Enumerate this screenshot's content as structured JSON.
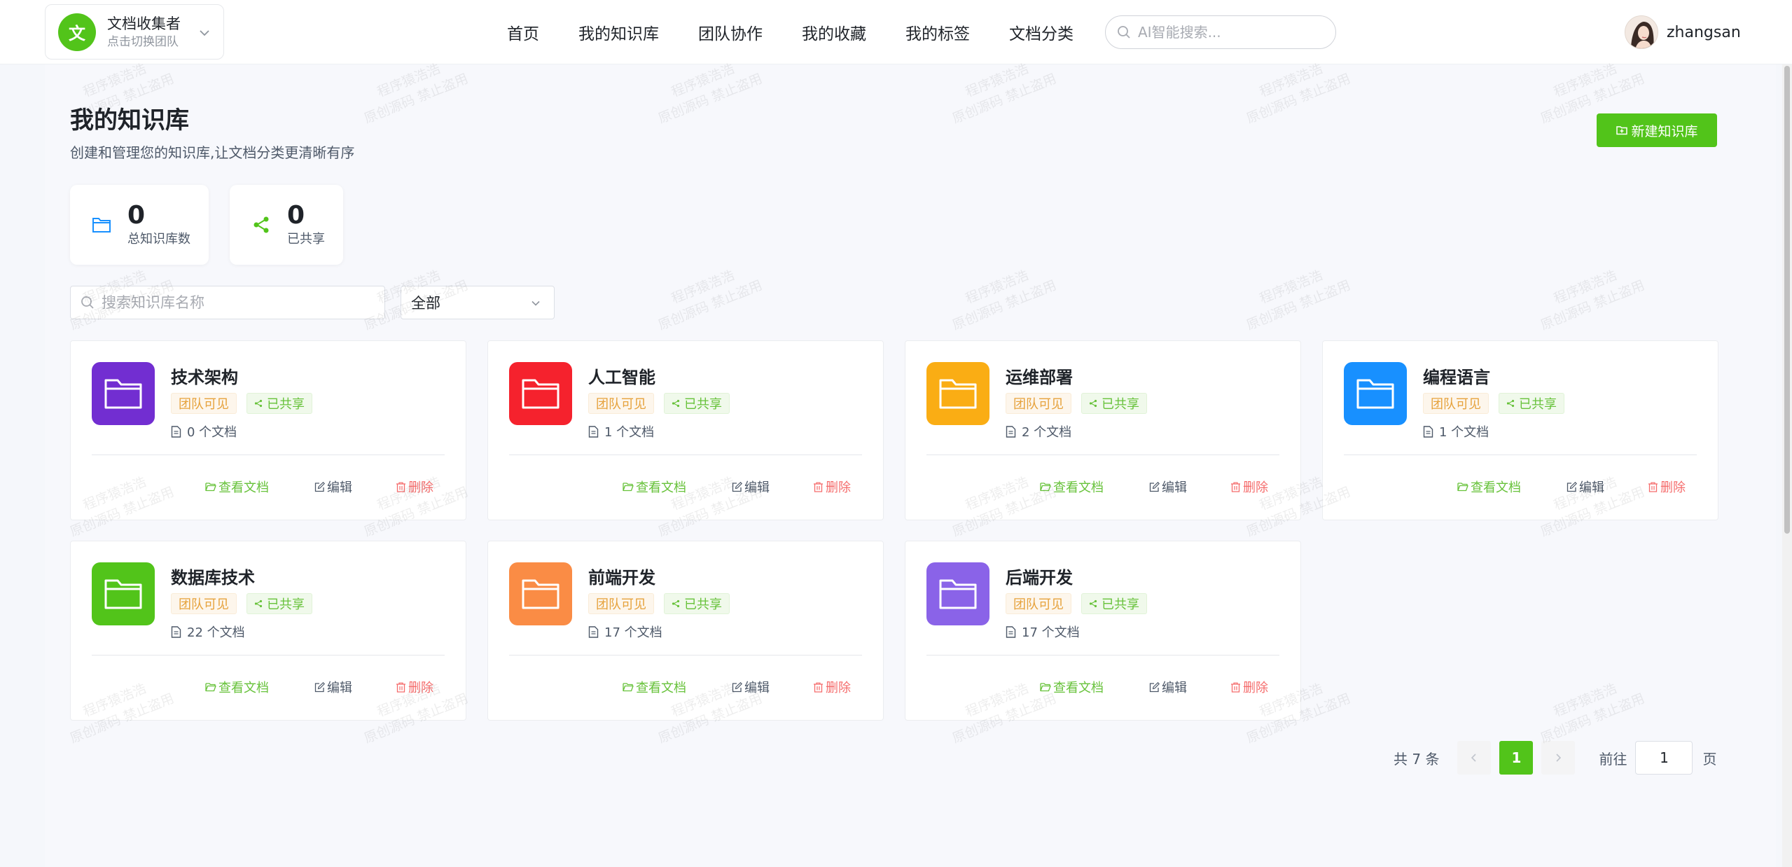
{
  "team": {
    "avatar_letter": "文",
    "name": "文档收集者",
    "subtitle": "点击切换团队"
  },
  "nav": [
    "首页",
    "我的知识库",
    "团队协作",
    "我的收藏",
    "我的标签",
    "文档分类"
  ],
  "search": {
    "placeholder": "AI智能搜索...",
    "value": ""
  },
  "user": {
    "name": "zhangsan"
  },
  "page": {
    "title": "我的知识库",
    "subtitle": "创建和管理您的知识库,让文档分类更清晰有序",
    "new_button": "新建知识库"
  },
  "stats": [
    {
      "value": "0",
      "label": "总知识库数"
    },
    {
      "value": "0",
      "label": "已共享"
    }
  ],
  "filters": {
    "search_placeholder": "搜索知识库名称",
    "select_value": "全部"
  },
  "tags": {
    "team": "团队可见",
    "shared": "已共享"
  },
  "actions": {
    "view": "查看文档",
    "edit": "编辑",
    "delete": "删除"
  },
  "cards": [
    {
      "title": "技术架构",
      "docs": "0 个文档",
      "color": "#722ed1"
    },
    {
      "title": "人工智能",
      "docs": "1 个文档",
      "color": "#f5222d"
    },
    {
      "title": "运维部署",
      "docs": "2 个文档",
      "color": "#faad14"
    },
    {
      "title": "编程语言",
      "docs": "1 个文档",
      "color": "#1890ff"
    },
    {
      "title": "数据库技术",
      "docs": "22 个文档",
      "color": "#52c41a"
    },
    {
      "title": "前端开发",
      "docs": "17 个文档",
      "color": "#fa8c45"
    },
    {
      "title": "后端开发",
      "docs": "17 个文档",
      "color": "#8a63e8"
    }
  ],
  "pagination": {
    "total": "共 7 条",
    "current": "1",
    "goto_label": "前往",
    "goto_value": "1",
    "page_label": "页"
  },
  "watermark": {
    "line1": "程序猿浩浩",
    "line2": "原创源码 禁止盗用"
  },
  "colors": {
    "accent": "#52c41a",
    "team_tag": "#e6a23c",
    "shared_tag": "#67c23a",
    "delete": "#f56c6c"
  }
}
